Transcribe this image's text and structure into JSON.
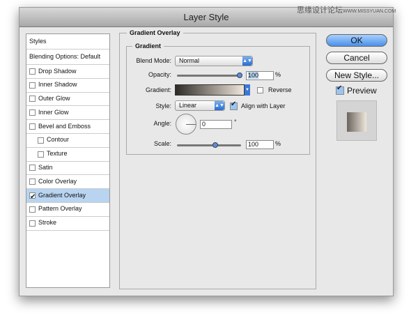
{
  "watermark": {
    "cn": "思缘设计论坛",
    "url": "WWW.MISSYUAN.COM"
  },
  "window": {
    "title": "Layer Style"
  },
  "sidebar": {
    "header": "Styles",
    "blending": "Blending Options: Default",
    "items": [
      {
        "label": "Drop Shadow",
        "checked": false,
        "indent": false
      },
      {
        "label": "Inner Shadow",
        "checked": false,
        "indent": false
      },
      {
        "label": "Outer Glow",
        "checked": false,
        "indent": false
      },
      {
        "label": "Inner Glow",
        "checked": false,
        "indent": false
      },
      {
        "label": "Bevel and Emboss",
        "checked": false,
        "indent": false
      },
      {
        "label": "Contour",
        "checked": false,
        "indent": true
      },
      {
        "label": "Texture",
        "checked": false,
        "indent": true
      },
      {
        "label": "Satin",
        "checked": false,
        "indent": false
      },
      {
        "label": "Color Overlay",
        "checked": false,
        "indent": false
      },
      {
        "label": "Gradient Overlay",
        "checked": true,
        "indent": false,
        "selected": true
      },
      {
        "label": "Pattern Overlay",
        "checked": false,
        "indent": false
      },
      {
        "label": "Stroke",
        "checked": false,
        "indent": false
      }
    ]
  },
  "panel": {
    "title": "Gradient Overlay",
    "group": "Gradient",
    "blend_label": "Blend Mode:",
    "blend_value": "Normal",
    "opacity_label": "Opacity:",
    "opacity_value": "100",
    "opacity_unit": "%",
    "gradient_label": "Gradient:",
    "gradient_colors": [
      "#2e2b28",
      "#efe6da"
    ],
    "reverse_label": "Reverse",
    "reverse_checked": false,
    "style_label": "Style:",
    "style_value": "Linear",
    "align_label": "Align with Layer",
    "align_checked": true,
    "angle_label": "Angle:",
    "angle_value": "0",
    "angle_unit": "°",
    "scale_label": "Scale:",
    "scale_value": "100",
    "scale_unit": "%"
  },
  "buttons": {
    "ok": "OK",
    "cancel": "Cancel",
    "new_style": "New Style...",
    "preview": "Preview",
    "preview_checked": true
  }
}
